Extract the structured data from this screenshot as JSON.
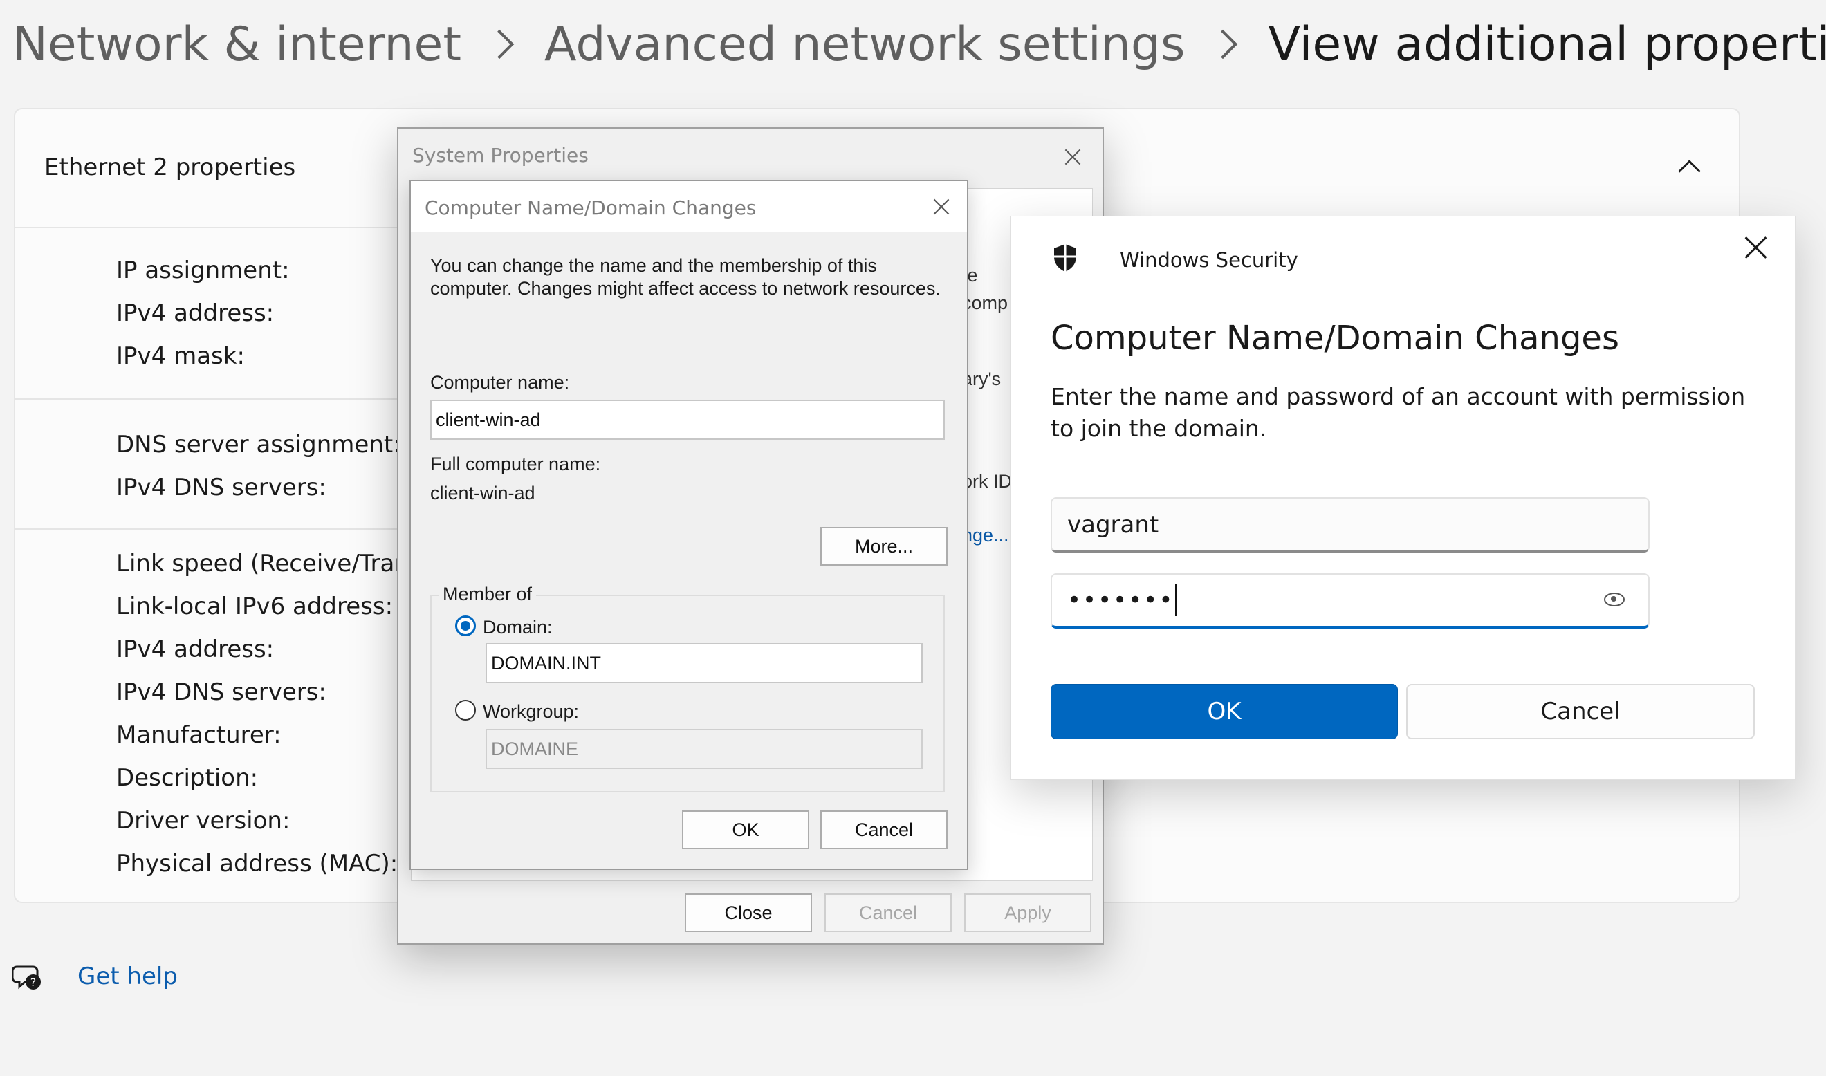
{
  "breadcrumb": {
    "items": [
      "Network & internet",
      "Advanced network settings",
      "View additional properties"
    ]
  },
  "card": {
    "title": "Ethernet 2 properties",
    "properties": [
      "IP assignment:",
      "IPv4 address:",
      "IPv4 mask:",
      "DNS server assignment:",
      "IPv4 DNS servers:",
      "Link speed (Receive/Transn",
      "Link-local IPv6 address:",
      "IPv4 address:",
      "IPv4 DNS servers:",
      "Manufacturer:",
      "Description:",
      "Driver version:",
      "Physical address (MAC):"
    ]
  },
  "help": {
    "label": "Get help"
  },
  "system_properties": {
    "title": "System Properties",
    "peek": [
      "te",
      "comp",
      "ary's",
      "ork ID",
      "nge..."
    ],
    "buttons": {
      "close": "Close",
      "cancel": "Cancel",
      "apply": "Apply"
    }
  },
  "name_dialog": {
    "title": "Computer Name/Domain Changes",
    "description": "You can change the name and the membership of this computer. Changes might affect access to network resources.",
    "computer_name_label": "Computer name:",
    "computer_name_value": "client-win-ad",
    "full_name_label": "Full computer name:",
    "full_name_value": "client-win-ad",
    "more_button": "More...",
    "member_of_label": "Member of",
    "domain_label": "Domain:",
    "domain_value": "DOMAIN.INT",
    "workgroup_label": "Workgroup:",
    "workgroup_value": "DOMAINE",
    "selected": "domain",
    "ok": "OK",
    "cancel": "Cancel"
  },
  "windows_security": {
    "app_name": "Windows Security",
    "heading": "Computer Name/Domain Changes",
    "description": "Enter the name and password of an account with permission to join the domain.",
    "username_value": "vagrant",
    "password_mask": "•••••••",
    "ok": "OK",
    "cancel": "Cancel",
    "accent_color": "#0067c0"
  }
}
